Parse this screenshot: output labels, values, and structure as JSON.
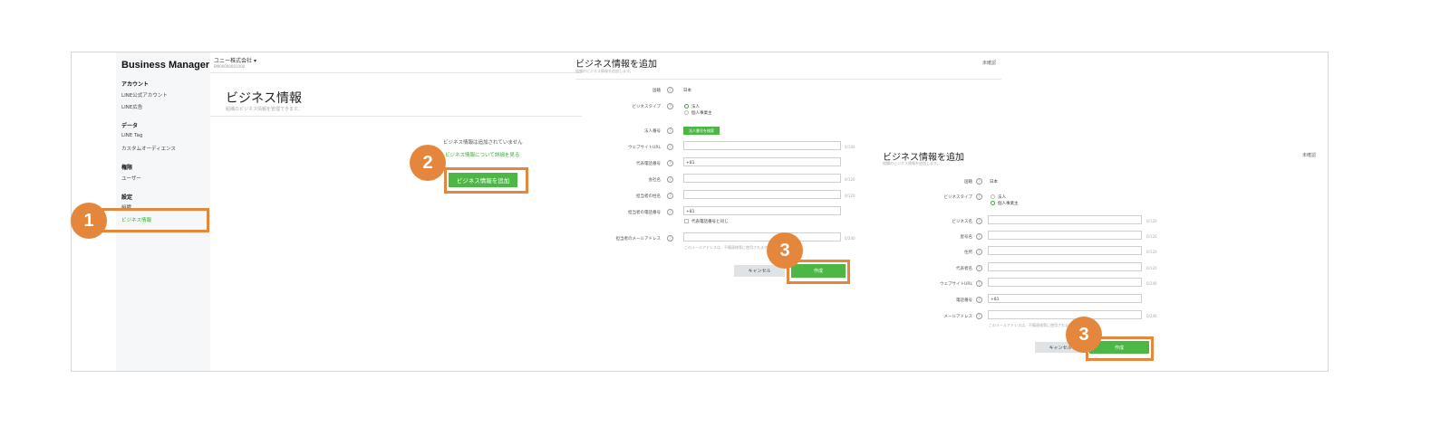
{
  "manager": {
    "brand": "Business Manager",
    "account_name": "ユニー株式会社",
    "account_id": "BM00000001000",
    "sidebar": {
      "sections": [
        {
          "heading": "アカウント",
          "items": [
            "LINE公式アカウント",
            "LINE広告"
          ]
        },
        {
          "heading": "データ",
          "items": [
            "LINE Tag",
            "カスタムオーディエンス"
          ]
        },
        {
          "heading": "権限",
          "items": [
            "ユーザー"
          ]
        },
        {
          "heading": "設定",
          "items": [
            "組織",
            "ビジネス情報"
          ]
        }
      ]
    },
    "page_title": "ビジネス情報",
    "page_subtitle": "組織のビジネス情報を管理できます。",
    "empty_message": "ビジネス情報は追加されていません",
    "learn_link": "ビジネス情報について詳細を見る",
    "add_button": "ビジネス情報を追加"
  },
  "corporate_form": {
    "title": "ビジネス情報を追加",
    "subtitle": "組織のビジネス情報を追加します。",
    "status": "未確認",
    "country_label": "国籍",
    "country_value": "日本",
    "type_label": "ビジネスタイプ",
    "type_options": [
      "法人",
      "個人事業主"
    ],
    "corp_number_label": "法人番号",
    "corp_number_button": "法人番号を検索",
    "website_label": "ウェブサイトURL",
    "website_count": "0/100",
    "phone_label": "代表電話番号",
    "phone_prefix": "+81",
    "company_label": "会社名",
    "company_count": "0/120",
    "manager_label": "担当者の姓名",
    "manager_count": "0/120",
    "contact_phone_label": "担当者の電話番号",
    "contact_phone_prefix": "+81",
    "same_as_rep": "代表電話番号と同じ",
    "email_label": "担当者のメールアドレス",
    "email_count": "0/240",
    "email_hint": "このメールアドレスは、不備連絡等に使用されます。",
    "cancel_label": "キャンセル",
    "create_label": "作成"
  },
  "individual_form": {
    "title": "ビジネス情報を追加",
    "subtitle": "組織のビジネス情報を追加します。",
    "status": "未確認",
    "country_label": "国籍",
    "country_value": "日本",
    "type_label": "ビジネスタイプ",
    "type_options": [
      "法人",
      "個人事業主"
    ],
    "business_name_label": "ビジネス名",
    "business_name_count": "0/120",
    "trade_name_label": "屋号名",
    "trade_name_count": "0/120",
    "address_label": "住所",
    "address_count": "0/120",
    "rep_label": "代表者名",
    "rep_count": "0/120",
    "website_label": "ウェブサイトURL",
    "website_count": "0/240",
    "phone_label": "電話番号",
    "phone_prefix": "+81",
    "email_label": "メールアドレス",
    "email_count": "0/240",
    "email_hint": "このメールアドレスは、不備連絡等に使用されます。",
    "cancel_label": "キャンセル",
    "create_label": "作成"
  },
  "steps": [
    "1",
    "2",
    "3",
    "3"
  ],
  "colors": {
    "accent_green": "#4cb744",
    "highlight_orange": "#e4873c"
  }
}
